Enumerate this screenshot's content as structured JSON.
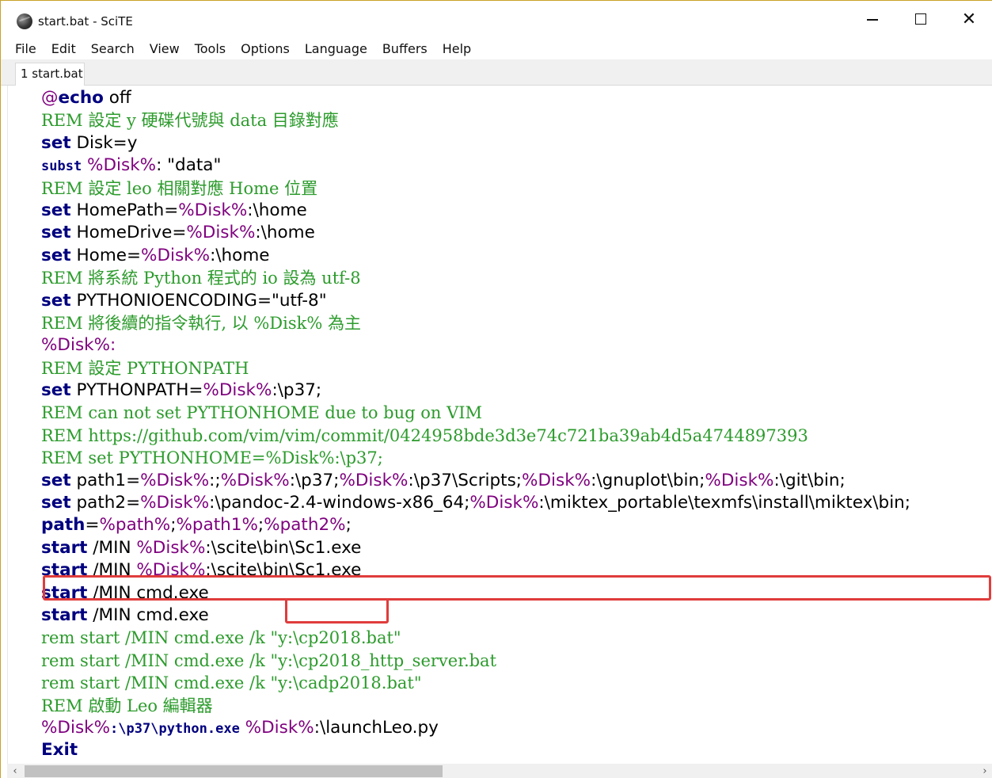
{
  "window": {
    "title": "start.bat - SciTE",
    "controls": {
      "minimize": "minimize-icon",
      "maximize": "maximize-icon",
      "close": "✕"
    }
  },
  "menubar": {
    "items": [
      "File",
      "Edit",
      "Search",
      "View",
      "Tools",
      "Options",
      "Language",
      "Buffers",
      "Help"
    ]
  },
  "tabs": [
    {
      "label": "1 start.bat",
      "active": true
    }
  ],
  "editor": {
    "lines": [
      [
        {
          "t": "@",
          "c": "lbl"
        },
        {
          "t": "echo",
          "c": "kw"
        },
        {
          "t": " off"
        }
      ],
      [
        {
          "t": "REM 設定 y 硬碟代號與 data 目錄對應",
          "c": "cmt"
        }
      ],
      [
        {
          "t": "set",
          "c": "kw"
        },
        {
          "t": " Disk=y"
        }
      ],
      [
        {
          "t": "subst",
          "c": "kw mono"
        },
        {
          "t": " "
        },
        {
          "t": "%Disk%",
          "c": "var"
        },
        {
          "t": ": \"data\""
        }
      ],
      [
        {
          "t": "REM 設定 leo 相關對應 Home 位置",
          "c": "cmt"
        }
      ],
      [
        {
          "t": "set",
          "c": "kw"
        },
        {
          "t": " HomePath="
        },
        {
          "t": "%Disk%",
          "c": "var"
        },
        {
          "t": ":\\home"
        }
      ],
      [
        {
          "t": "set",
          "c": "kw"
        },
        {
          "t": " HomeDrive="
        },
        {
          "t": "%Disk%",
          "c": "var"
        },
        {
          "t": ":\\home"
        }
      ],
      [
        {
          "t": "set",
          "c": "kw"
        },
        {
          "t": " Home="
        },
        {
          "t": "%Disk%",
          "c": "var"
        },
        {
          "t": ":\\home"
        }
      ],
      [
        {
          "t": "REM 將系統 Python 程式的 io 設為 utf-8",
          "c": "cmt"
        }
      ],
      [
        {
          "t": "set",
          "c": "kw"
        },
        {
          "t": " PYTHONIOENCODING=\"utf-8\""
        }
      ],
      [
        {
          "t": "REM 將後續的指令執行, 以 %Disk% 為主",
          "c": "cmt"
        }
      ],
      [
        {
          "t": "%Disk%:",
          "c": "lbl"
        }
      ],
      [
        {
          "t": "REM 設定 PYTHONPATH",
          "c": "cmt"
        }
      ],
      [
        {
          "t": "set",
          "c": "kw"
        },
        {
          "t": " PYTHONPATH="
        },
        {
          "t": "%Disk%",
          "c": "var"
        },
        {
          "t": ":\\p37;"
        }
      ],
      [
        {
          "t": "REM can not set PYTHONHOME due to bug on VIM",
          "c": "cmt"
        }
      ],
      [
        {
          "t": "REM https://github.com/vim/vim/commit/0424958bde3d3e74c721ba39ab4d5a4744897393",
          "c": "cmt"
        }
      ],
      [
        {
          "t": "REM set PYTHONHOME=%Disk%:\\p37;",
          "c": "cmt"
        }
      ],
      [
        {
          "t": "set",
          "c": "kw"
        },
        {
          "t": " path1="
        },
        {
          "t": "%Disk%",
          "c": "var"
        },
        {
          "t": ":;"
        },
        {
          "t": "%Disk%",
          "c": "var"
        },
        {
          "t": ":\\p37;"
        },
        {
          "t": "%Disk%",
          "c": "var"
        },
        {
          "t": ":\\p37\\Scripts;"
        },
        {
          "t": "%Disk%",
          "c": "var"
        },
        {
          "t": ":\\gnuplot\\bin;"
        },
        {
          "t": "%Disk%",
          "c": "var"
        },
        {
          "t": ":\\git\\bin;"
        }
      ],
      [
        {
          "t": "set",
          "c": "kw"
        },
        {
          "t": " path2="
        },
        {
          "t": "%Disk%",
          "c": "var"
        },
        {
          "t": ":\\pandoc-2.4-windows-x86_64;"
        },
        {
          "t": "%Disk%",
          "c": "var"
        },
        {
          "t": ":\\miktex_portable\\texmfs\\install\\miktex\\bin;"
        }
      ],
      [
        {
          "t": "path",
          "c": "kw"
        },
        {
          "t": "="
        },
        {
          "t": "%path%",
          "c": "var"
        },
        {
          "t": ";"
        },
        {
          "t": "%path1%",
          "c": "var"
        },
        {
          "t": ";"
        },
        {
          "t": "%path2%",
          "c": "var"
        },
        {
          "t": ";"
        }
      ],
      [
        {
          "t": "start",
          "c": "kw"
        },
        {
          "t": " /MIN "
        },
        {
          "t": "%Disk%",
          "c": "var"
        },
        {
          "t": ":\\scite\\bin\\Sc1.exe"
        }
      ],
      [
        {
          "t": "start",
          "c": "kw"
        },
        {
          "t": " /MIN "
        },
        {
          "t": "%Disk%",
          "c": "var"
        },
        {
          "t": ":\\scite\\bin\\Sc1.exe"
        }
      ],
      [
        {
          "t": "start",
          "c": "kw"
        },
        {
          "t": " /MIN cmd.exe"
        }
      ],
      [
        {
          "t": "start",
          "c": "kw"
        },
        {
          "t": " /MIN cmd.exe"
        }
      ],
      [
        {
          "t": "rem start /MIN cmd.exe /k \"y:\\cp2018.bat\"",
          "c": "cmt"
        }
      ],
      [
        {
          "t": "rem start /MIN cmd.exe /k \"y:\\cp2018_http_server.bat",
          "c": "cmt"
        }
      ],
      [
        {
          "t": "rem start /MIN cmd.exe /k \"y:\\cadp2018.bat\"",
          "c": "cmt"
        }
      ],
      [
        {
          "t": "REM 啟動 Leo 編輯器",
          "c": "cmt"
        }
      ],
      [
        {
          "t": "%Disk%",
          "c": "var"
        },
        {
          "t": ":\\p37\\python.exe",
          "c": "dos mono"
        },
        {
          "t": " "
        },
        {
          "t": "%Disk%",
          "c": "var"
        },
        {
          "t": ":\\launchLeo.py"
        }
      ],
      [
        {
          "t": "Exit",
          "c": "kw"
        }
      ]
    ],
    "highlight_color": "#e03c3c"
  },
  "scrollbar": {
    "left_arrow": "‹",
    "right_arrow": "›"
  }
}
